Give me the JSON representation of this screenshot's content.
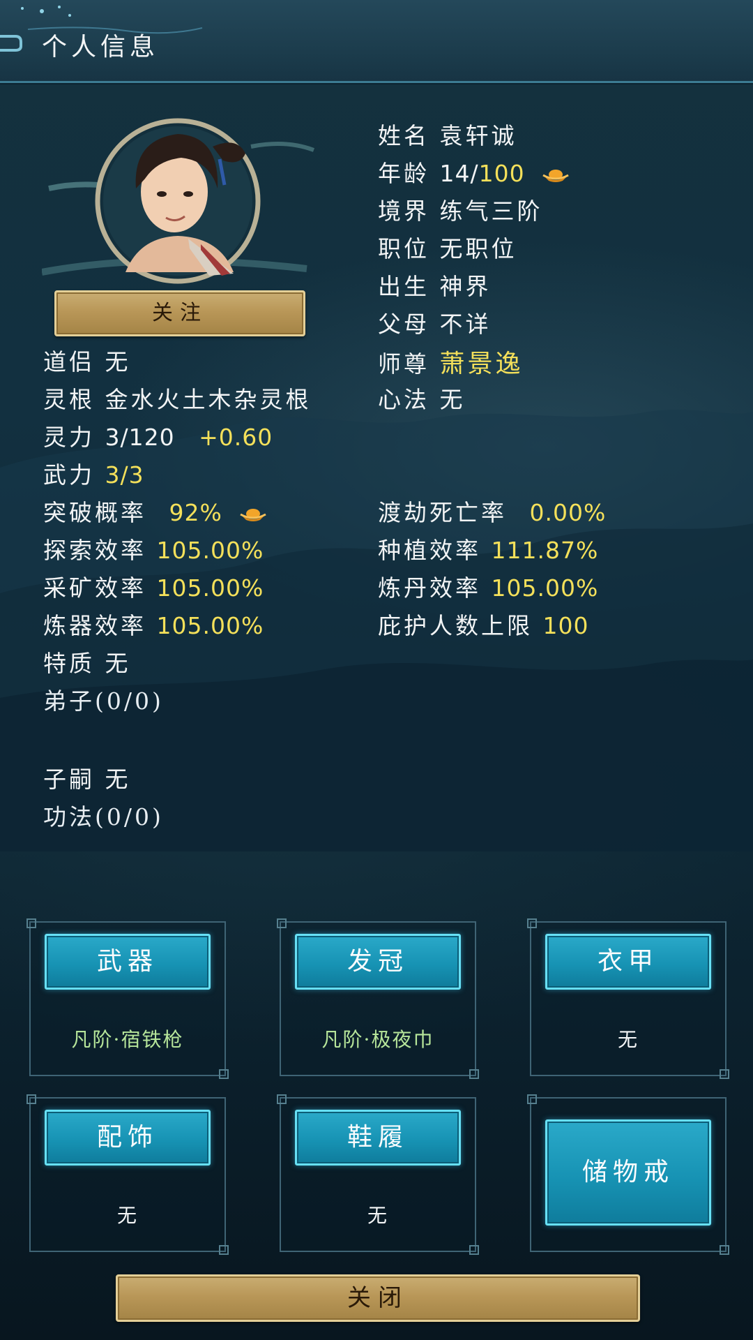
{
  "header": {
    "title": "个人信息"
  },
  "profile": {
    "follow_label": "关注",
    "name_label": "姓名",
    "name": "袁轩诚",
    "age_label": "年龄",
    "age_current": "14/",
    "age_max": "100",
    "realm_label": "境界",
    "realm": "练气三阶",
    "position_label": "职位",
    "position": "无职位",
    "birth_label": "出生",
    "birth": "神界",
    "parents_label": "父母",
    "parents": "不详",
    "master_label": "师尊",
    "master": "萧景逸",
    "method_label": "心法",
    "method": "无",
    "partner_label": "道侣",
    "partner": "无",
    "root_label": "灵根",
    "root": "金水火土木杂灵根",
    "spirit_label": "灵力",
    "spirit": "3/120",
    "spirit_bonus": "+0.60",
    "force_label": "武力",
    "force": "3/3",
    "breakthrough_label": "突破概率",
    "breakthrough": "92%",
    "tribulation_label": "渡劫死亡率",
    "tribulation": "0.00%",
    "explore_label": "探索效率",
    "explore": "105.00%",
    "plant_label": "种植效率",
    "plant": "111.87%",
    "mining_label": "采矿效率",
    "mining": "105.00%",
    "alchemy_label": "炼丹效率",
    "alchemy": "105.00%",
    "forge_label": "炼器效率",
    "forge": "105.00%",
    "protect_label": "庇护人数上限",
    "protect": "100",
    "trait_label": "特质",
    "trait": "无",
    "disciples": "弟子(0/0)",
    "heir_label": "子嗣",
    "heir": "无",
    "skills": "功法(0/0)"
  },
  "equipment": {
    "weapon": {
      "label": "武器",
      "value": "凡阶·宿铁枪"
    },
    "crown": {
      "label": "发冠",
      "value": "凡阶·极夜巾"
    },
    "armor": {
      "label": "衣甲",
      "value": "无"
    },
    "accessory": {
      "label": "配饰",
      "value": "无"
    },
    "shoes": {
      "label": "鞋履",
      "value": "无"
    },
    "ring": {
      "label": "储物戒"
    }
  },
  "footer": {
    "close_label": "关闭"
  },
  "colors": {
    "highlight": "#f4e05a",
    "equip_green": "#b6e59a",
    "gold": "#c9ad72",
    "cyan": "#1793b4"
  },
  "icons": {
    "ingot": "gold-ingot-icon",
    "portrait": "character-portrait"
  }
}
